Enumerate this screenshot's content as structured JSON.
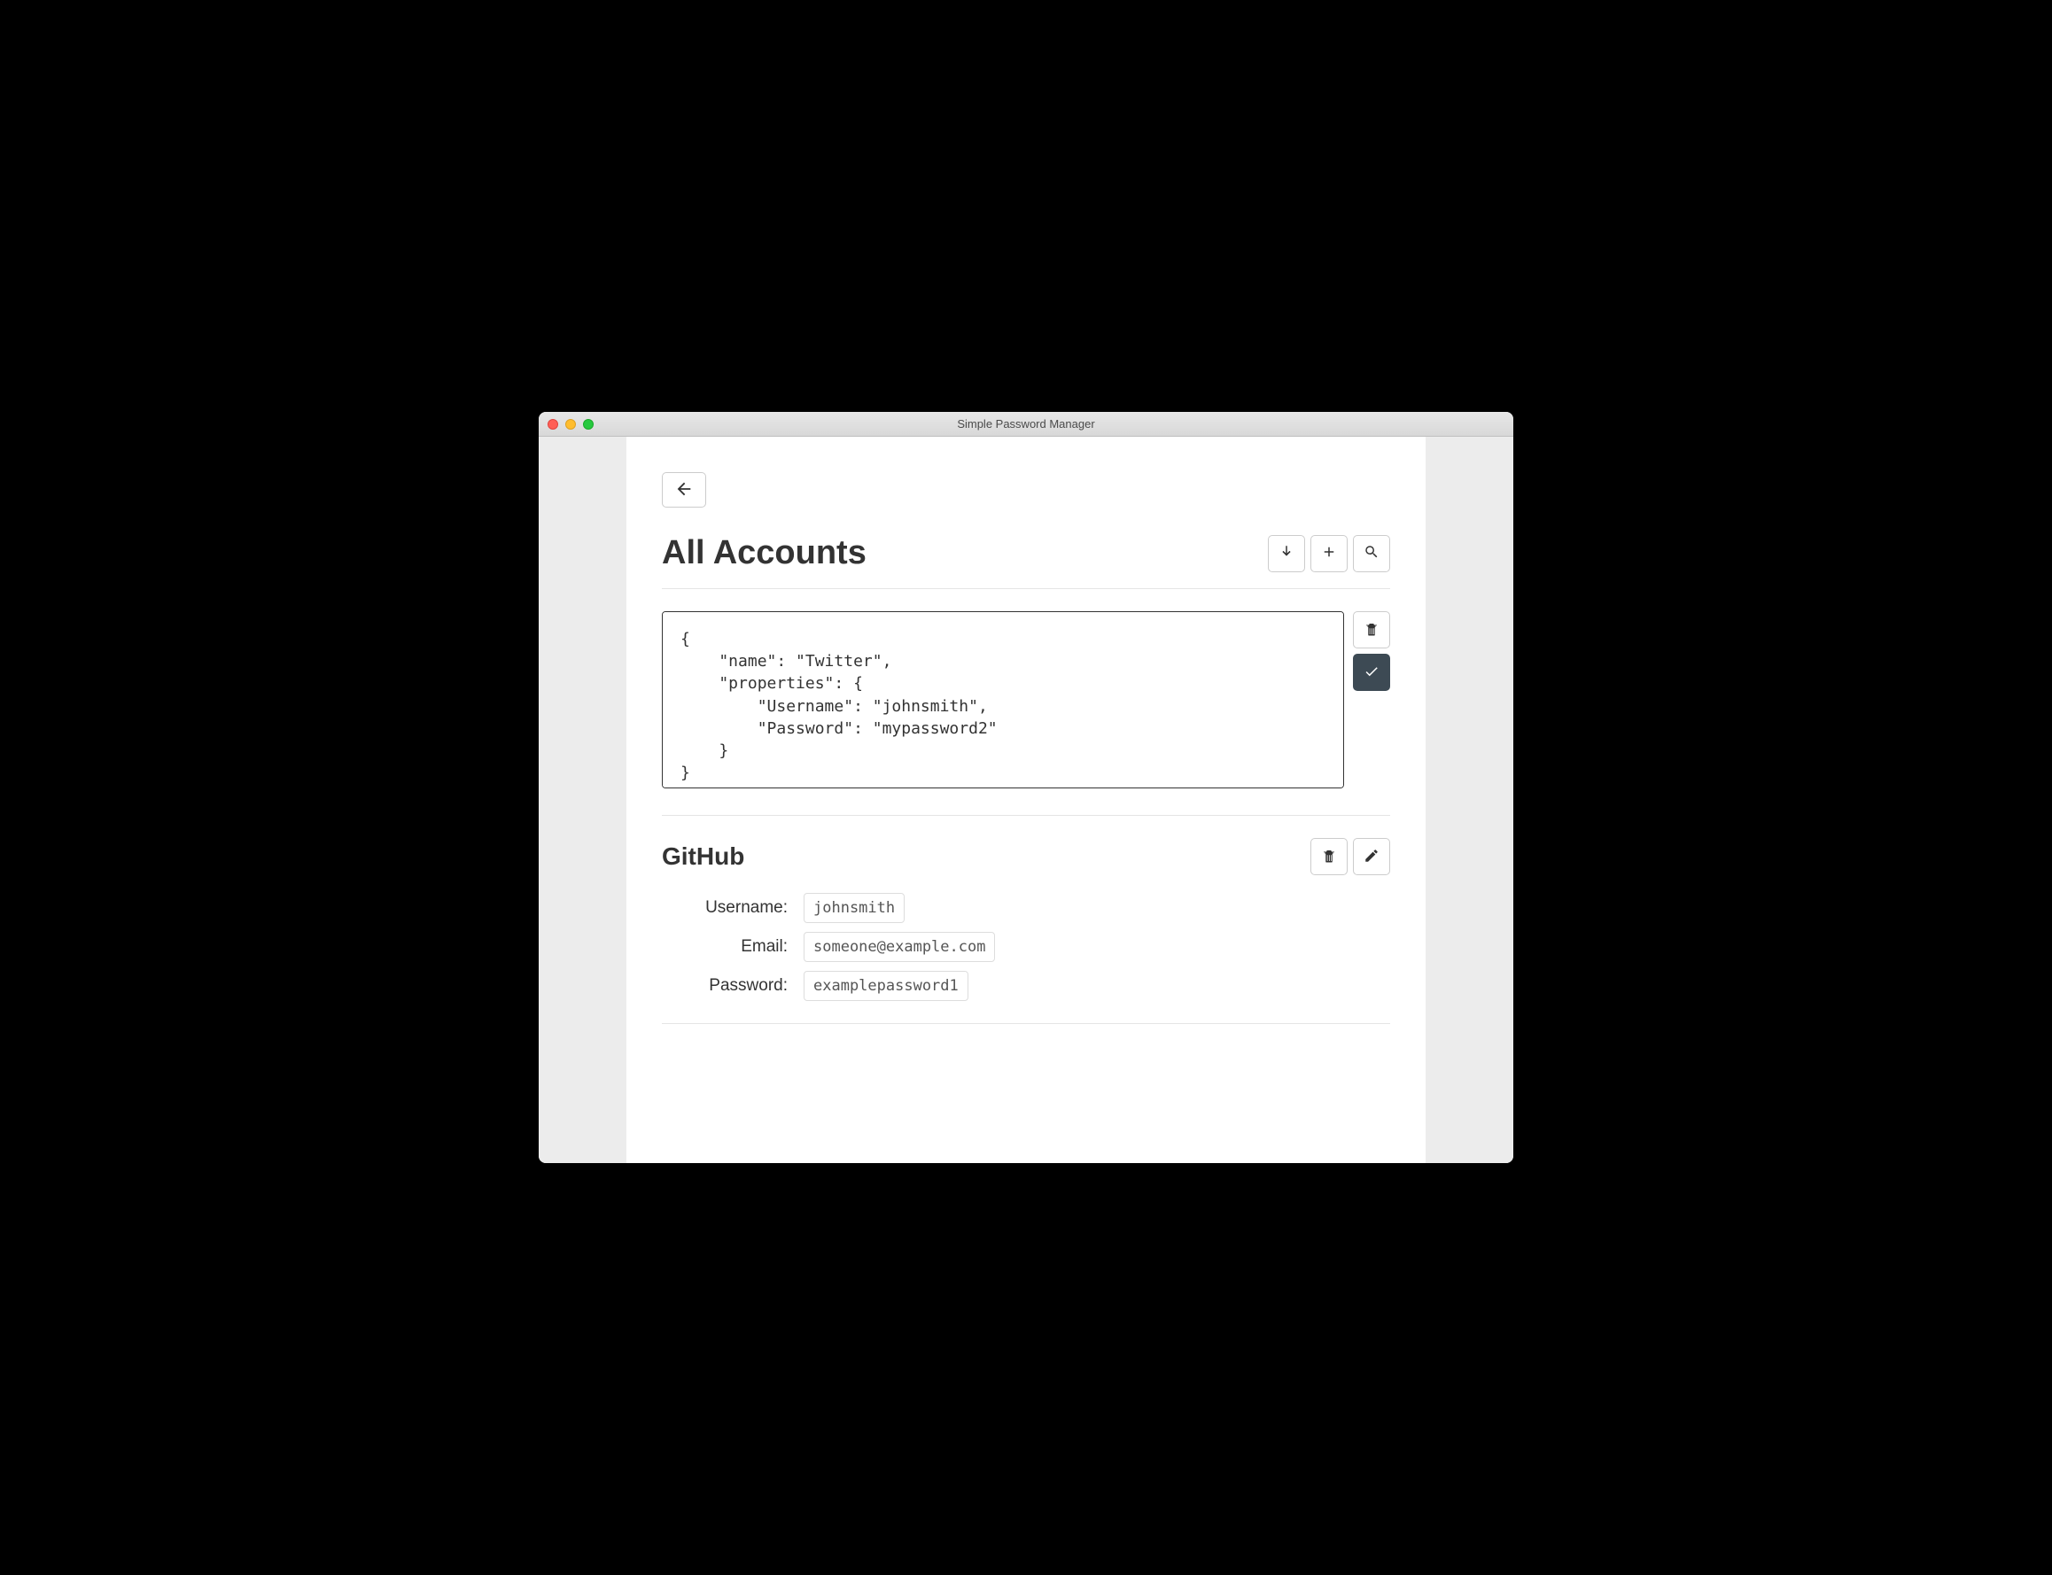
{
  "window": {
    "title": "Simple Password Manager"
  },
  "page": {
    "title": "All Accounts"
  },
  "editor": {
    "content": "{\n    \"name\": \"Twitter\",\n    \"properties\": {\n        \"Username\": \"johnsmith\",\n        \"Password\": \"mypassword2\"\n    }\n}"
  },
  "accounts": [
    {
      "name": "GitHub",
      "properties": [
        {
          "label": "Username:",
          "value": "johnsmith"
        },
        {
          "label": "Email:",
          "value": "someone@example.com"
        },
        {
          "label": "Password:",
          "value": "examplepassword1"
        }
      ]
    }
  ]
}
